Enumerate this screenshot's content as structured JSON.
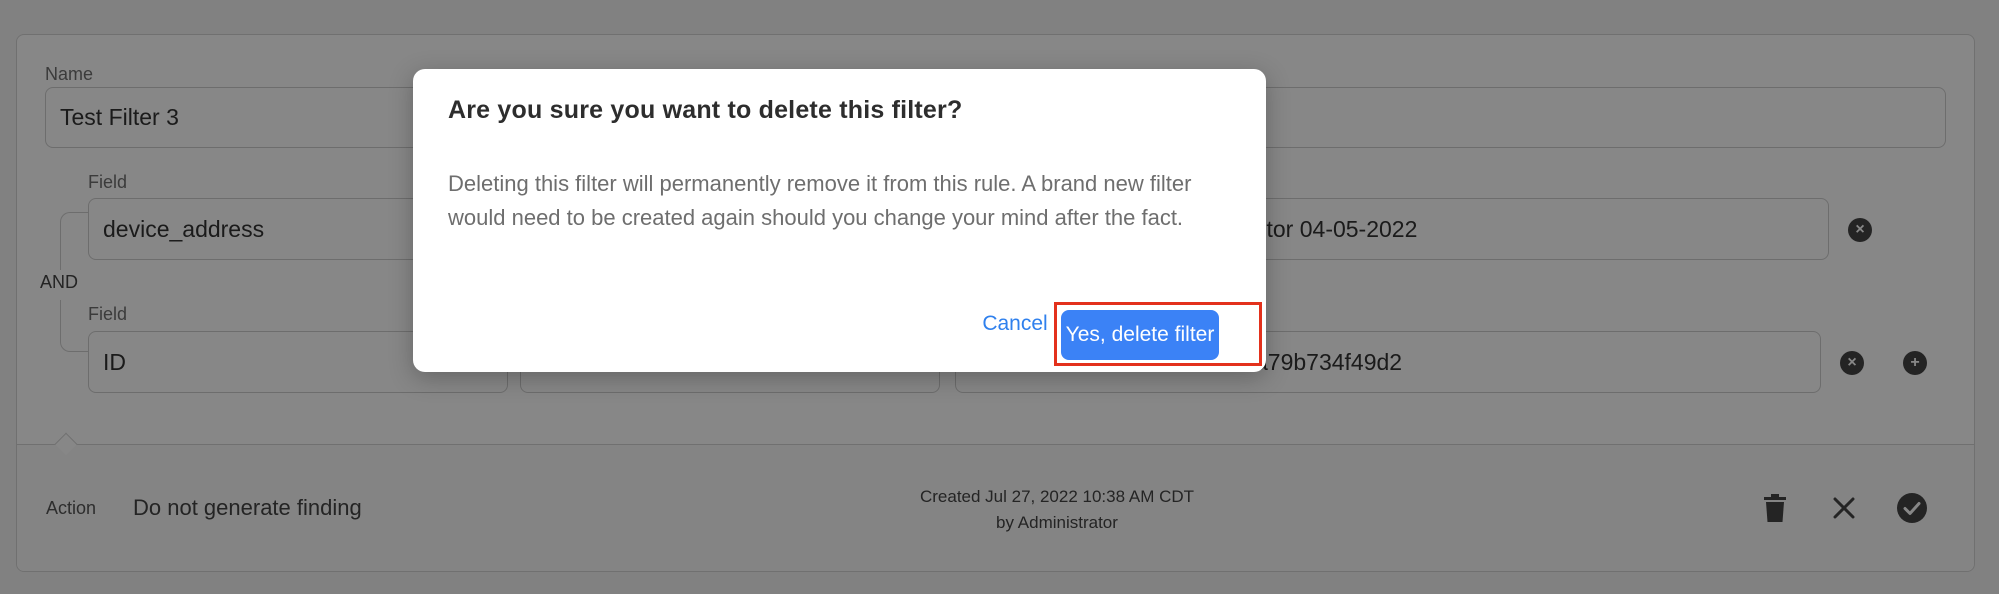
{
  "form": {
    "name_label": "Name",
    "name_value": "Test Filter 3",
    "conjunction": "AND",
    "conditions": [
      {
        "field_label": "Field",
        "field_value": "device_address",
        "value_tail": "ctor 04-05-2022"
      },
      {
        "field_label": "Field",
        "field_value": "ID",
        "value_tail": "a79b734f49d2"
      }
    ]
  },
  "footer": {
    "action_label": "Action",
    "action_value": "Do not generate finding",
    "created_line1": "Created Jul 27, 2022 10:38 AM CDT",
    "created_line2": "by Administrator"
  },
  "modal": {
    "title": "Are you sure you want to delete this filter?",
    "body": "Deleting this filter will permanently remove it from this rule. A brand new filter would need to be created again should you change your mind after the fact.",
    "cancel_label": "Cancel",
    "confirm_label": "Yes, delete filter"
  },
  "icons": {
    "remove": "close-circle-icon",
    "add": "plus-circle-icon",
    "delete": "trash-icon",
    "cancel": "close-icon",
    "save": "check-circle-icon"
  },
  "colors": {
    "primary": "#3b82f6",
    "link": "#2f80ed",
    "highlight": "#e3311c"
  }
}
